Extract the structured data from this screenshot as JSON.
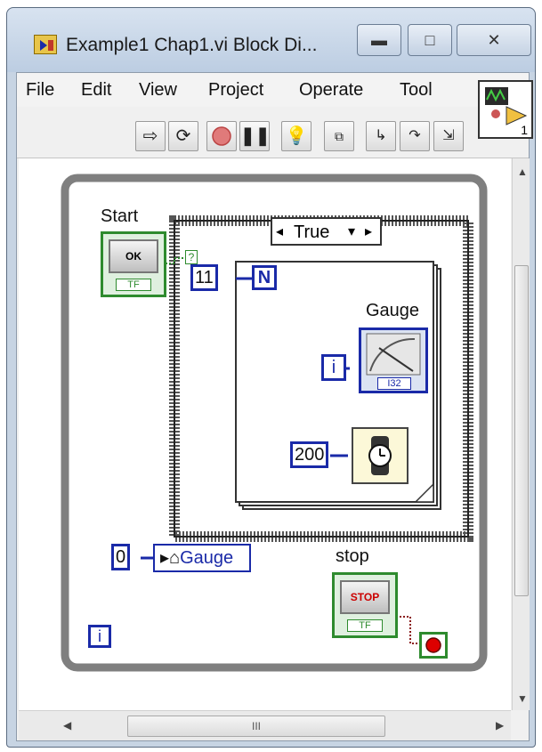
{
  "window": {
    "title": "Example1 Chap1.vi Block Di...",
    "min": "▬",
    "max": "□",
    "close": "✕"
  },
  "menu": [
    "File",
    "Edit",
    "View",
    "Project",
    "Operate",
    "Tool"
  ],
  "toolbar": {
    "vi_icon_number": "1"
  },
  "diagram": {
    "start_label": "Start",
    "start_button": "OK",
    "start_tf": "TF",
    "case_selector": "True",
    "loop_count_const": "11",
    "loop_n": "N",
    "gauge_label": "Gauge",
    "gauge_type": "I32",
    "iter_i": "i",
    "wait_const": "200",
    "init_const": "0",
    "property_node": "Gauge",
    "stop_label": "stop",
    "stop_button": "STOP",
    "stop_tf": "TF",
    "while_i": "i",
    "question": "?"
  },
  "scroll": {
    "thumb_grip": "III"
  },
  "colors": {
    "wire_blue": "#1a2aa8",
    "wire_green": "#2e8b2e",
    "while_frame": "#808080"
  }
}
